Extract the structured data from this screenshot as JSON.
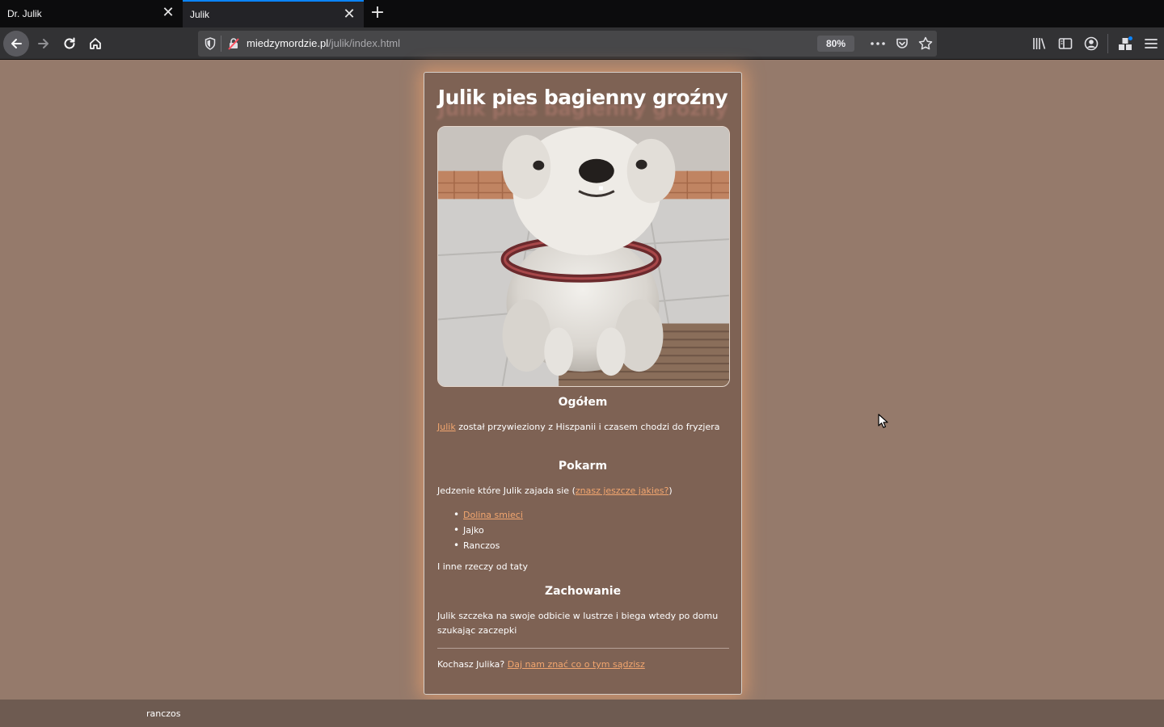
{
  "browser": {
    "tabs": [
      {
        "title": "Dr. Julik",
        "active": false
      },
      {
        "title": "Julik",
        "active": true
      }
    ],
    "url": {
      "domain": "miedzymordzie.pl",
      "path": "/julik/index.html"
    },
    "zoom": "80%",
    "colors": {
      "tab_accent": "#0a84ff",
      "toolbar": "#323234",
      "tabstrip": "#0c0c0d"
    }
  },
  "page": {
    "title": "Julik pies bagienny groźny",
    "photo_alt": "Julik",
    "sections": {
      "general": {
        "heading": "Ogółem",
        "link": "Julik",
        "text": " został przywieziony z Hiszpanii i czasem chodzi do fryzjera"
      },
      "food": {
        "heading": "Pokarm",
        "intro": "Jedzenie które Julik zajada sie (",
        "intro_link": "znasz jeszcze jakies?",
        "intro_end": ")",
        "items": [
          {
            "label": "Dolina smieci",
            "link": true
          },
          {
            "label": "Jajko",
            "link": false
          },
          {
            "label": "Ranczos",
            "link": false
          }
        ],
        "outro": "I inne rzeczy od taty"
      },
      "behavior": {
        "heading": "Zachowanie",
        "text": "Julik szczeka na swoje odbicie w lustrze i biega wtedy po domu szukając zaczepki"
      },
      "footer": {
        "text": "Kochasz Julika? ",
        "link": "Daj nam znać co o tym sądzisz"
      }
    },
    "colors": {
      "background": "#957a6b",
      "card": "#7e6254",
      "link": "#f2a66f",
      "glow": "#ffaa6e"
    }
  },
  "statusbar": {
    "text": "ranczos"
  }
}
